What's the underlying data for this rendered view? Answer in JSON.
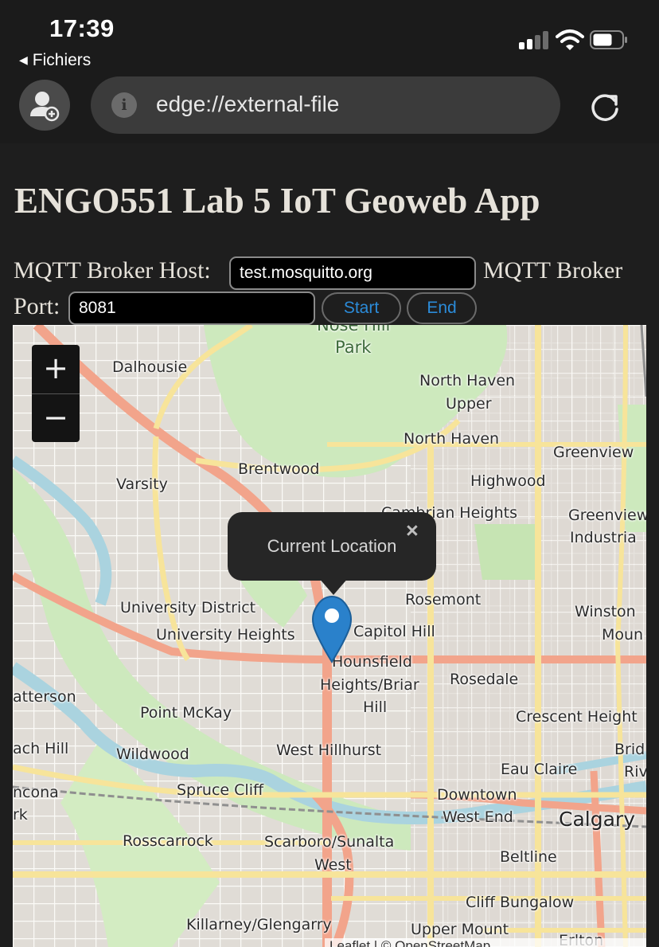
{
  "status_bar": {
    "time": "17:39",
    "back_app": "Fichiers",
    "icons": [
      "cellular-signal-icon",
      "wifi-icon",
      "battery-icon"
    ]
  },
  "browser": {
    "url": "edge://external-file",
    "icons": [
      "profile-icon",
      "info-icon",
      "reload-icon"
    ]
  },
  "page": {
    "title": "ENGO551 Lab 5 IoT Geoweb App",
    "host_label": "MQTT Broker Host:",
    "host_value": "test.mosquitto.org",
    "port_label_part1": "MQTT Broker",
    "port_label_part2": "Port:",
    "port_value": "8081",
    "start_label": "Start",
    "end_label": "End"
  },
  "map": {
    "zoom_in": "+",
    "zoom_out": "−",
    "popup_text": "Current Location",
    "popup_close": "×",
    "attribution": "Leaflet | © OpenStreetMap",
    "places": [
      {
        "id": "nose-hill",
        "text": "Nose Hill"
      },
      {
        "id": "park",
        "text": "Park"
      },
      {
        "id": "dalhousie",
        "text": "Dalhousie"
      },
      {
        "id": "north-haven-upper-1",
        "text": "North Haven"
      },
      {
        "id": "north-haven-upper-2",
        "text": "Upper"
      },
      {
        "id": "north-haven",
        "text": "North Haven"
      },
      {
        "id": "greenview",
        "text": "Greenview"
      },
      {
        "id": "brentwood",
        "text": "Brentwood"
      },
      {
        "id": "varsity",
        "text": "Varsity"
      },
      {
        "id": "highwood",
        "text": "Highwood"
      },
      {
        "id": "cambrian-heights",
        "text": "Cambrian Heights"
      },
      {
        "id": "greenview-industrial-1",
        "text": "Greenview"
      },
      {
        "id": "greenview-industrial-2",
        "text": "Industria"
      },
      {
        "id": "rosemont",
        "text": "Rosemont"
      },
      {
        "id": "university-district",
        "text": "University District"
      },
      {
        "id": "university-heights",
        "text": "University Heights"
      },
      {
        "id": "capitol-hill",
        "text": "Capitol Hill"
      },
      {
        "id": "winston-1",
        "text": "Winston"
      },
      {
        "id": "winston-2",
        "text": "Moun"
      },
      {
        "id": "hounsfield-1",
        "text": "Hounsfield"
      },
      {
        "id": "hounsfield-2",
        "text": "Heights/Briar"
      },
      {
        "id": "hounsfield-3",
        "text": "Hill"
      },
      {
        "id": "rosedale",
        "text": "Rosedale"
      },
      {
        "id": "patterson",
        "text": "atterson"
      },
      {
        "id": "point-mckay",
        "text": "Point McKay"
      },
      {
        "id": "crescent-heights",
        "text": "Crescent Height"
      },
      {
        "id": "coach-hill",
        "text": "ach Hill"
      },
      {
        "id": "wildwood",
        "text": "Wildwood"
      },
      {
        "id": "west-hillhurst",
        "text": "West Hillhurst"
      },
      {
        "id": "bridgeland",
        "text": "Brid"
      },
      {
        "id": "riverside",
        "text": "Riv"
      },
      {
        "id": "eau-claire",
        "text": "Eau Claire"
      },
      {
        "id": "strathcona-1",
        "text": "ncona"
      },
      {
        "id": "strathcona-2",
        "text": "rk"
      },
      {
        "id": "spruce-cliff",
        "text": "Spruce Cliff"
      },
      {
        "id": "downtown",
        "text": "Downtown"
      },
      {
        "id": "west-end",
        "text": "West End"
      },
      {
        "id": "calgary",
        "text": "Calgary"
      },
      {
        "id": "rosscarrock",
        "text": "Rosscarrock"
      },
      {
        "id": "scarboro",
        "text": "Scarboro/Sunalta"
      },
      {
        "id": "scarboro-west",
        "text": "West"
      },
      {
        "id": "beltline",
        "text": "Beltline"
      },
      {
        "id": "cliff-bungalow",
        "text": "Cliff Bungalow"
      },
      {
        "id": "killarney",
        "text": "Killarney/Glengarry"
      },
      {
        "id": "upper-mount",
        "text": "Upper Mount"
      },
      {
        "id": "erlton",
        "text": "Erlton"
      }
    ]
  },
  "colors": {
    "link_blue": "#2b8bd8",
    "page_bg": "#1e1e1e",
    "park_green": "#c9e7b4",
    "river_blue": "#aad3df",
    "major_road": "#f2a48b",
    "secondary_road": "#f7e49a"
  }
}
